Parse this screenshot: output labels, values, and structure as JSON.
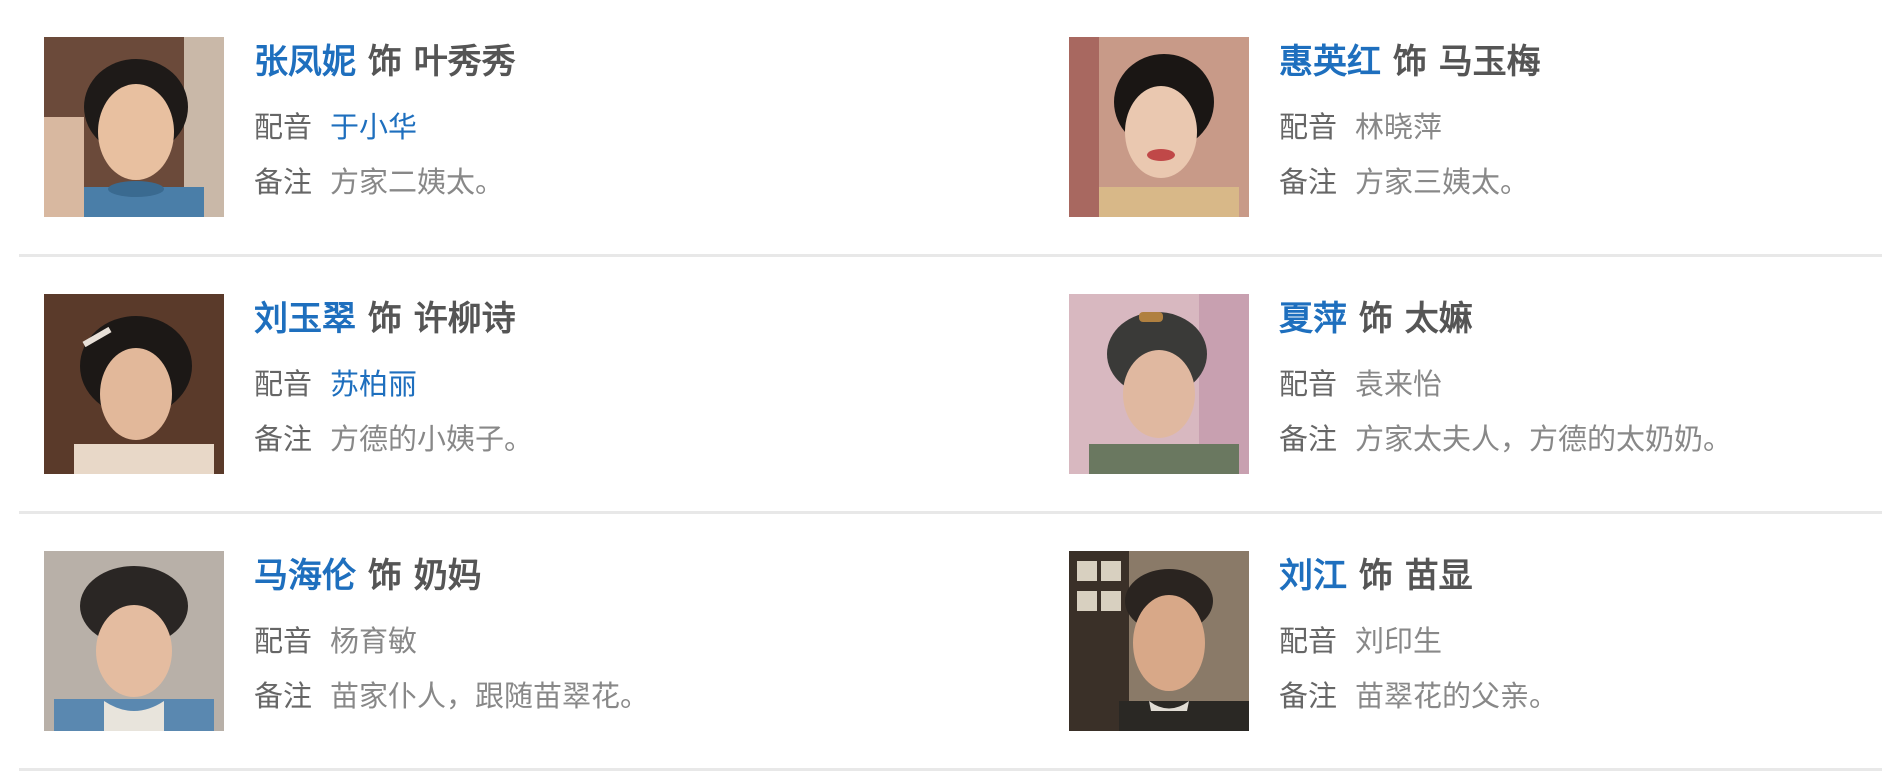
{
  "cast": [
    {
      "actor": "张凤妮",
      "connector": "饰",
      "role": "叶秀秀",
      "dub_label": "配音",
      "dub_value": "于小华",
      "dub_is_link": true,
      "note_label": "备注",
      "note_value": "方家二姨太。"
    },
    {
      "actor": "惠英红",
      "connector": "饰",
      "role": "马玉梅",
      "dub_label": "配音",
      "dub_value": "林晓萍",
      "dub_is_link": false,
      "note_label": "备注",
      "note_value": "方家三姨太。"
    },
    {
      "actor": "刘玉翠",
      "connector": "饰",
      "role": "许柳诗",
      "dub_label": "配音",
      "dub_value": "苏柏丽",
      "dub_is_link": true,
      "note_label": "备注",
      "note_value": "方德的小姨子。"
    },
    {
      "actor": "夏萍",
      "connector": "饰",
      "role": "太嫲",
      "dub_label": "配音",
      "dub_value": "袁来怡",
      "dub_is_link": false,
      "note_label": "备注",
      "note_value": "方家太夫人，方德的太奶奶。"
    },
    {
      "actor": "马海伦",
      "connector": "饰",
      "role": "奶妈",
      "dub_label": "配音",
      "dub_value": "杨育敏",
      "dub_is_link": false,
      "note_label": "备注",
      "note_value": "苗家仆人，跟随苗翠花。"
    },
    {
      "actor": "刘江",
      "connector": "饰",
      "role": "苗显",
      "dub_label": "配音",
      "dub_value": "刘印生",
      "dub_is_link": false,
      "note_label": "备注",
      "note_value": "苗翠花的父亲。"
    }
  ],
  "colors": {
    "actor_link": "#1e6fbe",
    "role_text": "#555555",
    "label_text": "#666666",
    "value_text": "#888888",
    "divider": "#e8e8e8"
  }
}
